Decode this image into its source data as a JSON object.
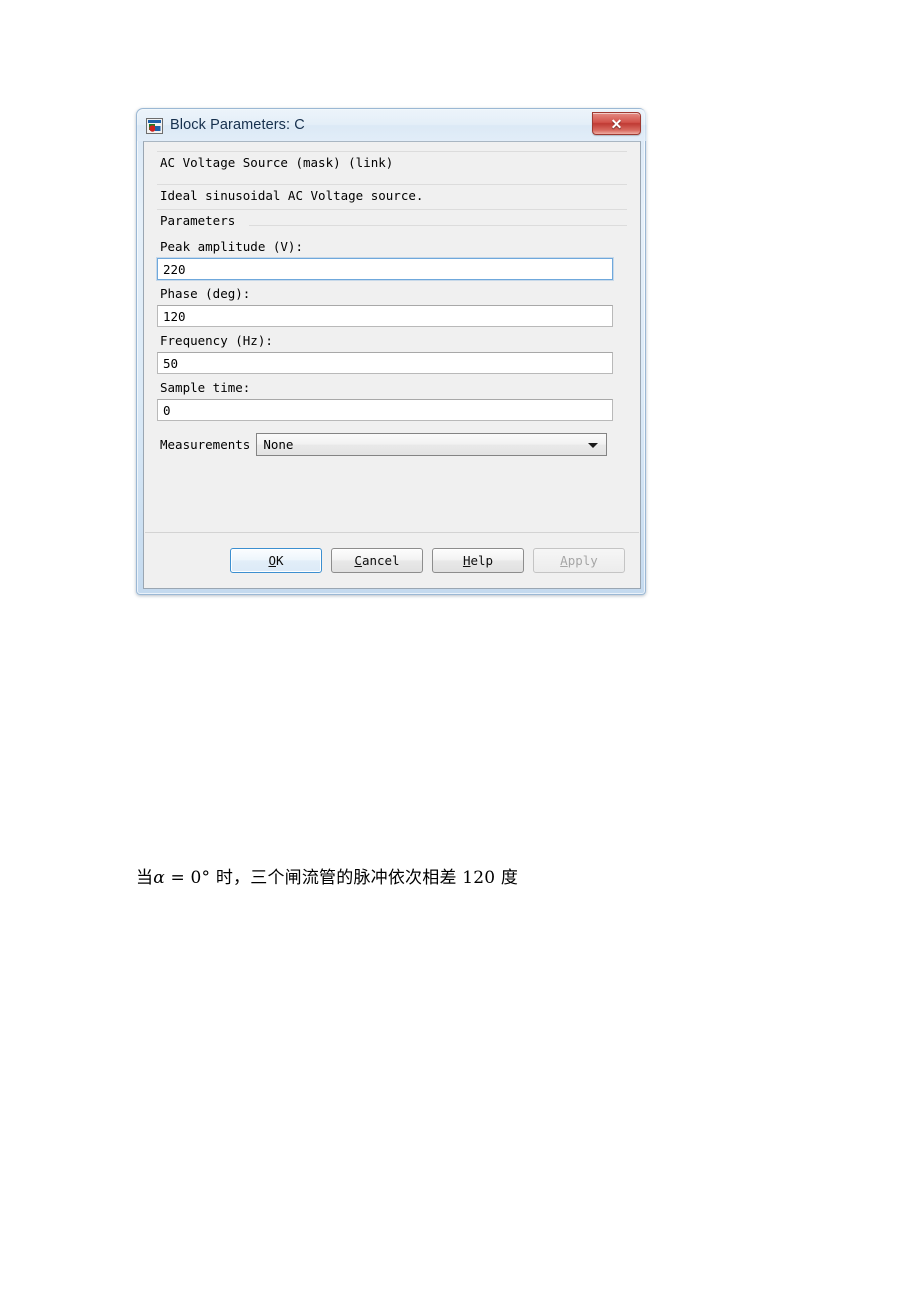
{
  "page": {
    "background_color": "#ffffff",
    "body_text_prefix": "当",
    "body_text_alpha": "α",
    "body_text_eq": " = 0° 时，三个闸流管的脉冲依次相差 120 度"
  },
  "dialog": {
    "title": "Block Parameters: C",
    "icon": "simulink-block-icon",
    "close_glyph": "✕",
    "close_label": "Close",
    "accent_color": "#3c8fd0",
    "frame_color": "#9bb8d4",
    "client_background": "#f0f0f0"
  },
  "description": {
    "heading": "AC Voltage Source (mask) (link)",
    "body": "Ideal sinusoidal AC Voltage source."
  },
  "parameters_section": {
    "heading": "Parameters",
    "fields": [
      {
        "label": "Peak amplitude (V):",
        "value": "220",
        "focused": true
      },
      {
        "label": "Phase (deg):",
        "value": "120",
        "focused": false
      },
      {
        "label": "Frequency (Hz):",
        "value": "50",
        "focused": false
      },
      {
        "label": "Sample time:",
        "value": "0",
        "focused": false
      }
    ],
    "measurements": {
      "label": "Measurements",
      "value": "None",
      "arrow": "chevron-down-icon"
    }
  },
  "buttons": [
    {
      "name": "ok",
      "mnemonic": "O",
      "rest": "K",
      "default": true,
      "disabled": false
    },
    {
      "name": "cancel",
      "mnemonic": "C",
      "rest": "ancel",
      "default": false,
      "disabled": false
    },
    {
      "name": "help",
      "mnemonic": "H",
      "rest": "elp",
      "default": false,
      "disabled": false
    },
    {
      "name": "apply",
      "mnemonic": "A",
      "rest": "pply",
      "default": false,
      "disabled": true
    }
  ]
}
